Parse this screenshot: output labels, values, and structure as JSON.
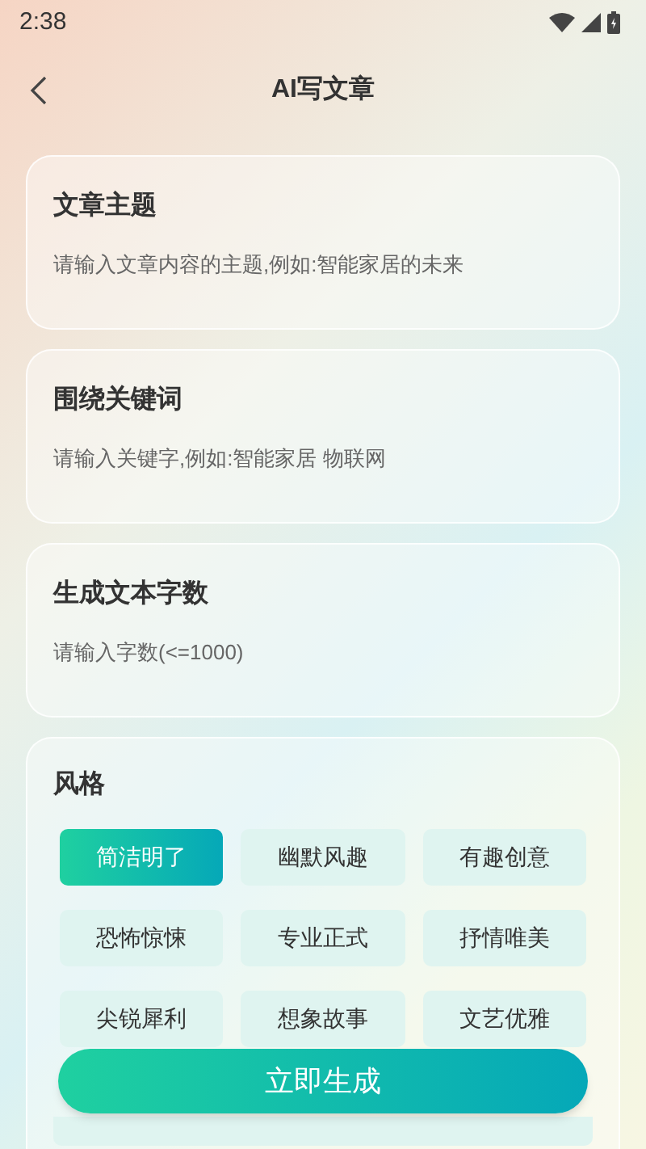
{
  "status_bar": {
    "time": "2:38"
  },
  "header": {
    "title": "AI写文章"
  },
  "fields": [
    {
      "label": "文章主题",
      "placeholder": "请输入文章内容的主题,例如:智能家居的未来"
    },
    {
      "label": "围绕关键词",
      "placeholder": "请输入关键字,例如:智能家居 物联网"
    },
    {
      "label": "生成文本字数",
      "placeholder": "请输入字数(<=1000)"
    }
  ],
  "style": {
    "label": "风格",
    "options": [
      {
        "label": "简洁明了",
        "selected": true
      },
      {
        "label": "幽默风趣",
        "selected": false
      },
      {
        "label": "有趣创意",
        "selected": false
      },
      {
        "label": "恐怖惊悚",
        "selected": false
      },
      {
        "label": "专业正式",
        "selected": false
      },
      {
        "label": "抒情唯美",
        "selected": false
      },
      {
        "label": "尖锐犀利",
        "selected": false
      },
      {
        "label": "想象故事",
        "selected": false
      },
      {
        "label": "文艺优雅",
        "selected": false
      }
    ]
  },
  "generate_button": {
    "label": "立即生成"
  }
}
